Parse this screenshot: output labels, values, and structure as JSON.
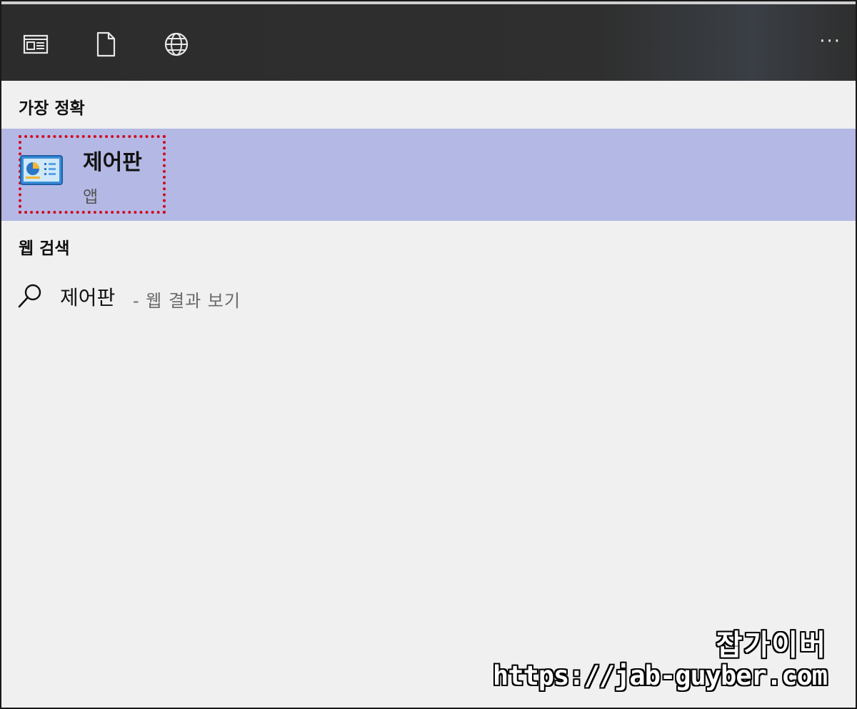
{
  "toolbar": {
    "icons": [
      "app-window-icon",
      "document-icon",
      "globe-icon"
    ],
    "more_label": "···"
  },
  "sections": {
    "best_match_title": "가장 정확",
    "web_search_title": "웹 검색"
  },
  "best_match": {
    "name": "제어판",
    "type": "앱",
    "icon": "control-panel-icon"
  },
  "web_result": {
    "query": "제어판",
    "suffix": "- 웹 결과 보기",
    "icon": "search-icon"
  },
  "watermark": {
    "name": "잡가이버",
    "url": "https://jab-guyber.com"
  },
  "colors": {
    "toolbar_bg": "#2e2e2e",
    "panel_bg": "#f0f0f0",
    "selected_bg": "#b4b8e4",
    "highlight_border": "#d10a1f"
  }
}
